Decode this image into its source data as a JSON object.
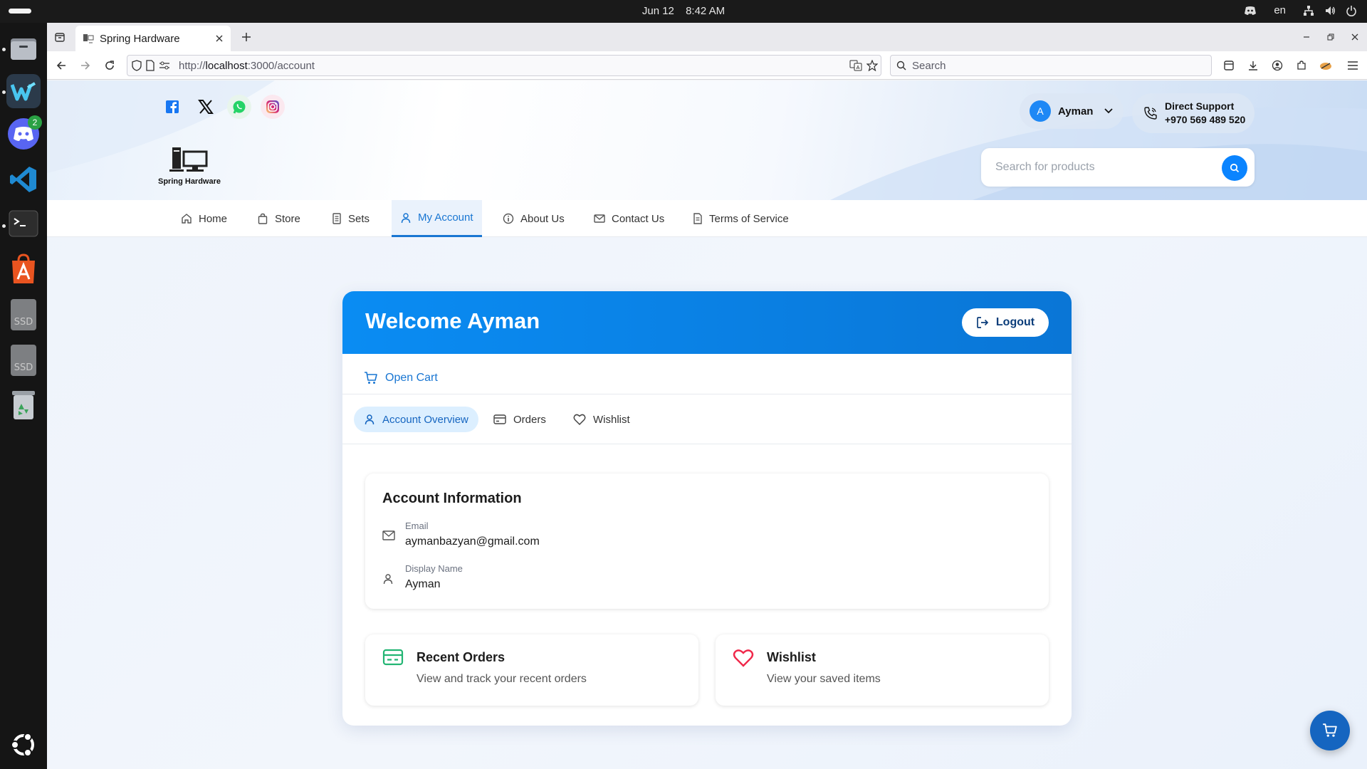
{
  "system": {
    "date": "Jun 12",
    "time": "8:42 AM",
    "lang": "en"
  },
  "dock": {
    "items": [
      "files-icon",
      "windsurf-icon",
      "discord-icon",
      "vscode-icon",
      "terminal-icon",
      "app-center-icon",
      "ssd-drive-icon",
      "ssd-drive-icon",
      "trash-icon",
      "ubuntu-icon"
    ],
    "discord_badge": "2",
    "ssd_label": "SSD"
  },
  "browser": {
    "tab_title": "Spring Hardware",
    "url_prefix": "http://",
    "url_host": "localhost",
    "url_path": ":3000/account",
    "search_placeholder": "Search"
  },
  "site": {
    "logo_text": "Spring Hardware",
    "user_name": "Ayman",
    "user_initial": "A",
    "support_title": "Direct Support",
    "support_phone": "+970 569 489 520",
    "search_placeholder": "Search for products",
    "nav": [
      {
        "label": "Home",
        "icon": "home-icon"
      },
      {
        "label": "Store",
        "icon": "bag-icon"
      },
      {
        "label": "Sets",
        "icon": "list-icon"
      },
      {
        "label": "My Account",
        "icon": "user-icon",
        "active": true
      },
      {
        "label": "About Us",
        "icon": "info-icon"
      },
      {
        "label": "Contact Us",
        "icon": "mail-icon"
      },
      {
        "label": "Terms of Service",
        "icon": "document-icon"
      }
    ]
  },
  "account": {
    "welcome": "Welcome Ayman",
    "logout": "Logout",
    "open_cart": "Open Cart",
    "tabs": [
      {
        "label": "Account Overview",
        "active": true
      },
      {
        "label": "Orders"
      },
      {
        "label": "Wishlist"
      }
    ],
    "info_title": "Account Information",
    "email_label": "Email",
    "email_value": "aymanbazyan@gmail.com",
    "display_label": "Display Name",
    "display_value": "Ayman",
    "cards": [
      {
        "title": "Recent Orders",
        "desc": "View and track your recent orders"
      },
      {
        "title": "Wishlist",
        "desc": "View your saved items"
      }
    ]
  },
  "colors": {
    "primary": "#0a84ff",
    "header_gradient_start": "#0a8cf3",
    "header_gradient_end": "#0a76d6",
    "orders_icon": "#22b573",
    "wishlist_icon": "#f0284a"
  }
}
